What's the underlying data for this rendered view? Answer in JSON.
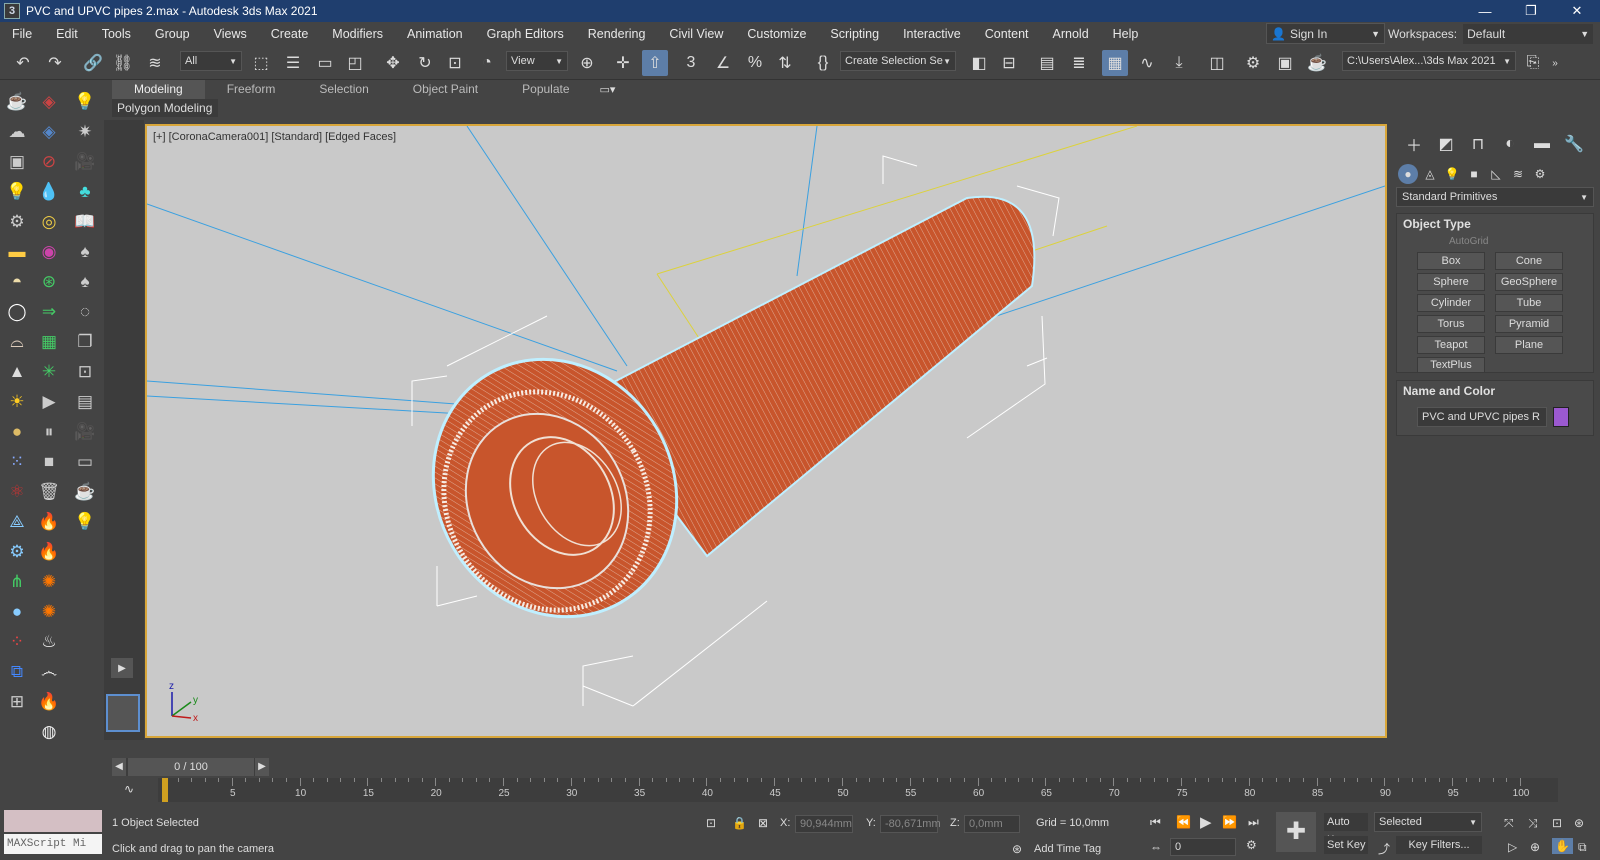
{
  "window": {
    "app_icon_glyph": "3",
    "title": "PVC and UPVC pipes 2.max - Autodesk 3ds Max 2021",
    "minimize_glyph": "—",
    "maximize_glyph": "❐",
    "close_glyph": "✕"
  },
  "menu": [
    "File",
    "Edit",
    "Tools",
    "Group",
    "Views",
    "Create",
    "Modifiers",
    "Animation",
    "Graph Editors",
    "Rendering",
    "Civil View",
    "Customize",
    "Scripting",
    "Interactive",
    "Content",
    "Arnold",
    "Help"
  ],
  "signin": {
    "label": "Sign In"
  },
  "workspaces": {
    "label": "Workspaces:",
    "value": "Default"
  },
  "toolbar": {
    "selection_filter": "All",
    "ref_coord": "View",
    "named_selection": "Create Selection Se",
    "project_path": "C:\\Users\\Alex...\\3ds Max 2021"
  },
  "ribbon": {
    "tabs": [
      "Modeling",
      "Freeform",
      "Selection",
      "Object Paint",
      "Populate"
    ],
    "active": "Modeling",
    "sub": "Polygon Modeling"
  },
  "viewport": {
    "label": "[+] [CoronaCamera001] [Standard] [Edged Faces]",
    "axis": {
      "x": "x",
      "y": "y",
      "z": "z"
    }
  },
  "command_panel": {
    "dropdown": "Standard Primitives",
    "object_type": {
      "title": "Object Type",
      "autogrid": "AutoGrid",
      "buttons": [
        "Box",
        "Cone",
        "Sphere",
        "GeoSphere",
        "Cylinder",
        "Tube",
        "Torus",
        "Pyramid",
        "Teapot",
        "Plane",
        "TextPlus"
      ]
    },
    "name_color": {
      "title": "Name and Color",
      "name": "PVC and UPVC pipes R",
      "color": "#9b59d0"
    }
  },
  "timeline": {
    "frame": "0 / 100",
    "ticks": [
      "0",
      "5",
      "10",
      "15",
      "20",
      "25",
      "30",
      "35",
      "40",
      "45",
      "50",
      "55",
      "60",
      "65",
      "70",
      "75",
      "80",
      "85",
      "90",
      "95",
      "100"
    ]
  },
  "status": {
    "maxscript": "MAXScript Mi",
    "selected": "1 Object Selected",
    "prompt": "Click and drag to pan the camera",
    "x_label": "X:",
    "x_val": "90,944mm",
    "y_label": "Y:",
    "y_val": "-80,671mm",
    "z_label": "Z:",
    "z_val": "0,0mm",
    "grid": "Grid = 10,0mm",
    "add_time_tag": "Add Time Tag",
    "auto_key": "Auto K...",
    "set_key": "Set Key",
    "selected_dd": "Selected",
    "key_filters": "Key Filters...",
    "frame_field": "0"
  }
}
